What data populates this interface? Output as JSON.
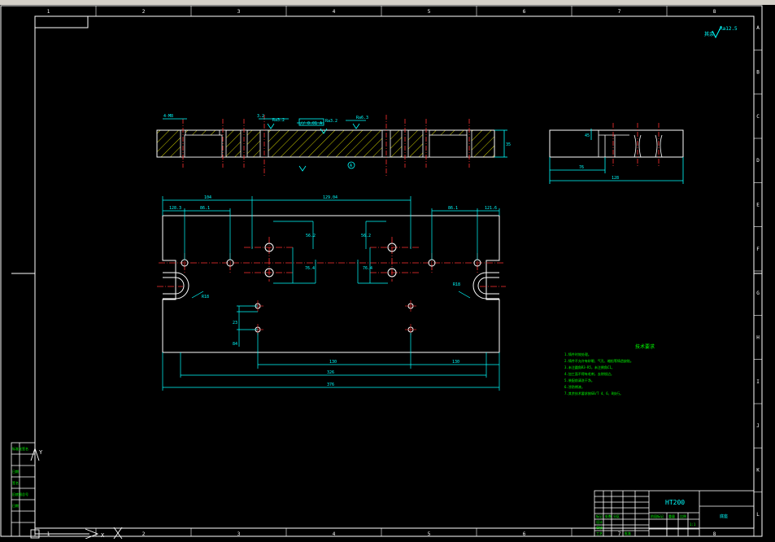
{
  "window": {
    "toolbar_strip": ""
  },
  "frame": {
    "columns": [
      "1",
      "2",
      "3",
      "4",
      "5",
      "6",
      "7",
      "8"
    ],
    "rows": [
      "A",
      "B",
      "C",
      "D",
      "E",
      "F",
      "G",
      "H",
      "I",
      "J",
      "K",
      "L"
    ]
  },
  "roughness_general": "其余",
  "roughness_value": "Ra12.5",
  "top_view": {
    "dims": [
      "4-M8",
      "3.2",
      "Ra3.2",
      "Ra3.2",
      "Ra6.3"
    ],
    "tolerance_frame": "// 0.01 A",
    "datum": "A",
    "height_dim": "35"
  },
  "side_view": {
    "dims": [
      "45",
      "76",
      "128"
    ]
  },
  "front_view": {
    "dims_top": [
      "104",
      "129.04",
      "128.3",
      "86.1",
      "86.1",
      "121.6"
    ],
    "dims_vertical": [
      "56.2",
      "56.2",
      "76.4",
      "76.4",
      "23",
      "84"
    ],
    "dims_bottom": [
      "130",
      "130",
      "326",
      "376"
    ],
    "radius_left": "R18",
    "radius_right": "R18"
  },
  "notes": {
    "title": "技术要求",
    "lines": [
      "1.铸件时效处理。",
      "2.铸件不允许有砂眼、气孔、缩松等铸造缺陷。",
      "3.未注圆角R3-R5，未注倒角C1。",
      "4.加工面不得有毛刺，去除锐边。",
      "5.装配前清洗干净。",
      "6.涂防锈漆。",
      "7.其余技术要求按GB/T 4、6、8执行。"
    ]
  },
  "title_block": {
    "material": "HT200",
    "part_name": "底座",
    "cells": [
      "标记",
      "处数",
      "分区",
      "设计",
      "审核",
      "工艺",
      "批准",
      "阶段标记",
      "重量",
      "比例",
      "1:1"
    ]
  },
  "left_panel": {
    "labels": [
      "标准化签名",
      "日期",
      "签名",
      "旧底图总号",
      "日期"
    ]
  },
  "ucs": {
    "y_label": "Y",
    "x_label": "X"
  }
}
